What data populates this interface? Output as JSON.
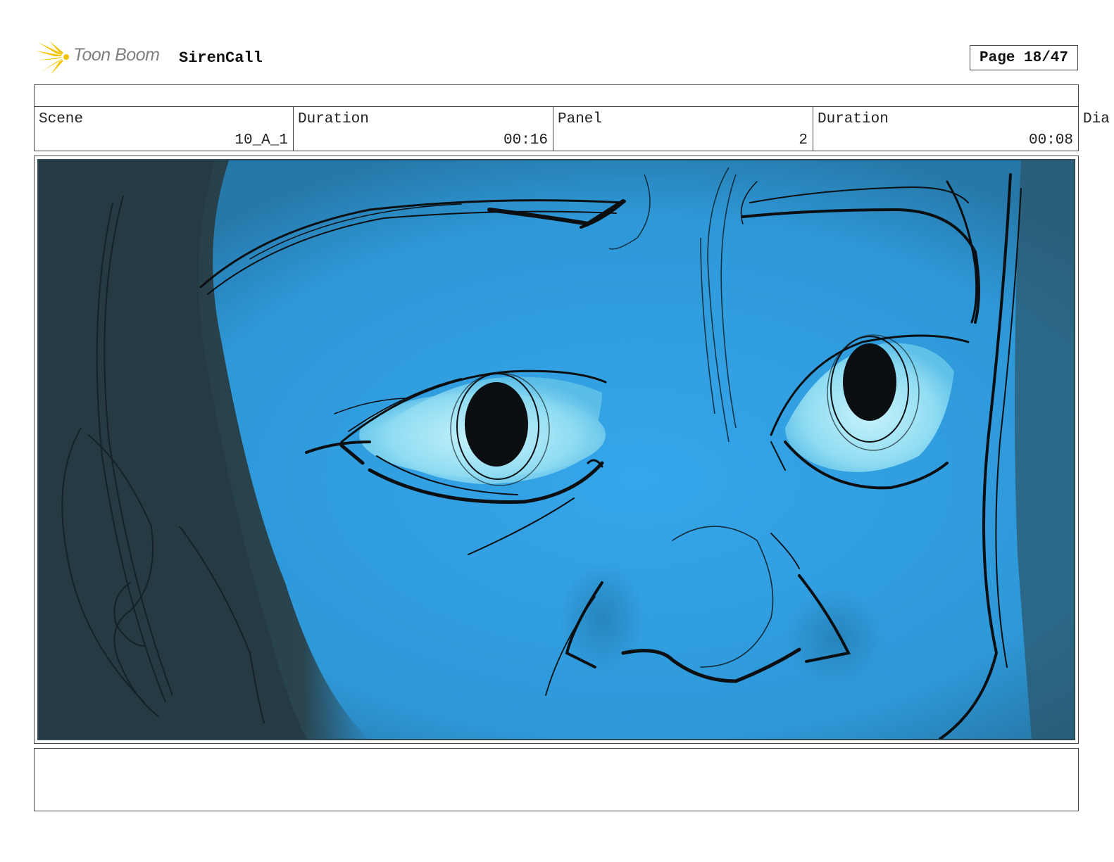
{
  "header": {
    "brand": "Toon Boom",
    "project": "SirenCall",
    "page": "Page 18/47"
  },
  "info": {
    "scene_label": "Scene",
    "scene_value": "10_A_1",
    "scene_duration_label": "Duration",
    "scene_duration_value": "00:16",
    "panel_label": "Panel",
    "panel_value": "2",
    "panel_duration_label": "Duration",
    "panel_duration_value": "00:08",
    "dialogue_label": "Dia"
  },
  "panel": {
    "image_subject": "closeup-face-sketch-icon",
    "colors": {
      "skin": "#2fa0e2",
      "shadow": "#263a42",
      "eye_white": "#a8e6f4",
      "line": "#0b0f12"
    }
  },
  "colors": {
    "logo_yellow": "#f5c400",
    "border": "#444444"
  }
}
